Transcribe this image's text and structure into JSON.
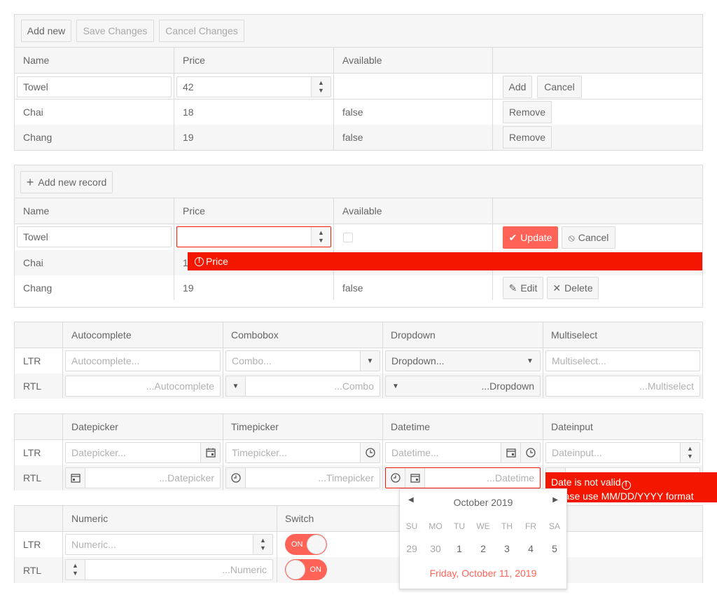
{
  "grid1": {
    "toolbar": {
      "add_new": "Add new",
      "save_changes": "Save Changes",
      "cancel_changes": "Cancel Changes"
    },
    "columns": [
      "Name",
      "Price",
      "Available",
      ""
    ],
    "edit_row": {
      "name_value": "Towel",
      "price_value": "42",
      "add_label": "Add",
      "cancel_label": "Cancel"
    },
    "rows": [
      {
        "name": "Chai",
        "price": "18",
        "available": "false",
        "action": "Remove"
      },
      {
        "name": "Chang",
        "price": "19",
        "available": "false",
        "action": "Remove"
      }
    ]
  },
  "grid2": {
    "toolbar": {
      "add_new_record": "Add new record"
    },
    "columns": [
      "Name",
      "Price",
      "Available",
      ""
    ],
    "edit_row": {
      "name_value": "Towel",
      "price_value": "",
      "update_label": "Update",
      "cancel_label": "Cancel"
    },
    "validation": {
      "message": "Price"
    },
    "rows": [
      {
        "name": "Chai",
        "price": "1"
      },
      {
        "name": "Chang",
        "price": "19",
        "available": "false",
        "edit_label": "Edit",
        "delete_label": "Delete"
      }
    ]
  },
  "table_dropdowns": {
    "columns": [
      "Autocomplete",
      "Combobox",
      "Dropdown",
      "Multiselect"
    ],
    "rows": [
      {
        "label": "LTR",
        "autocomplete": "Autocomplete...",
        "combobox": "Combo...",
        "dropdown": "Dropdown...",
        "multiselect": "Multiselect..."
      },
      {
        "label": "RTL",
        "autocomplete": "...Autocomplete",
        "combobox": "...Combo",
        "dropdown": "...Dropdown",
        "multiselect": "...Multiselect"
      }
    ]
  },
  "table_dates": {
    "columns": [
      "Datepicker",
      "Timepicker",
      "Datetime",
      "Dateinput"
    ],
    "rows": [
      {
        "label": "LTR",
        "datepicker": "Datepicker...",
        "timepicker": "Timepicker...",
        "datetime": "Datetime...",
        "dateinput": "Dateinput..."
      },
      {
        "label": "RTL",
        "datepicker": "...Datepicker",
        "timepicker": "...Timepicker",
        "datetime": "...Datetime"
      }
    ],
    "error": {
      "line1": "Date is not valid",
      "line2": "please use MM/DD/YYYY format"
    }
  },
  "table_numeric": {
    "columns": [
      "Numeric",
      "Switch"
    ],
    "rows": [
      {
        "label": "LTR",
        "numeric": "Numeric...",
        "switch_label": "ON"
      },
      {
        "label": "RTL",
        "numeric": "...Numeric",
        "switch_label": "ON"
      }
    ]
  },
  "calendar": {
    "title": "October 2019",
    "weekdays": [
      "SU",
      "MO",
      "TU",
      "WE",
      "TH",
      "FR",
      "SA"
    ],
    "days": [
      "29",
      "30",
      "1",
      "2",
      "3",
      "4",
      "5"
    ],
    "footer": "Friday, October 11, 2019"
  },
  "colors": {
    "primary": "#ff6358",
    "error": "#f31700",
    "border": "#dbdbdb",
    "header_bg": "#f6f6f6"
  }
}
